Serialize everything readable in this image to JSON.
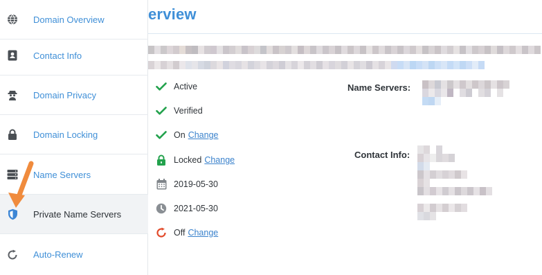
{
  "sidebar": {
    "items": [
      {
        "label": "Domain Overview",
        "icon": "globe-icon"
      },
      {
        "label": "Contact Info",
        "icon": "contact-card-icon"
      },
      {
        "label": "Domain Privacy",
        "icon": "privacy-agent-icon"
      },
      {
        "label": "Domain Locking",
        "icon": "lock-icon"
      },
      {
        "label": "Name Servers",
        "icon": "server-icon"
      },
      {
        "label": "Private Name Servers",
        "icon": "shield-icon"
      },
      {
        "label": "Auto-Renew",
        "icon": "renew-icon"
      }
    ],
    "active_item": "Private Name Servers"
  },
  "main": {
    "title_partial": "erview",
    "status": [
      {
        "icon": "check-icon",
        "text": "Active",
        "link": ""
      },
      {
        "icon": "check-icon",
        "text": "Verified",
        "link": ""
      },
      {
        "icon": "check-icon",
        "text": "On",
        "link": "Change"
      },
      {
        "icon": "lock-icon",
        "text": "Locked",
        "link": "Change"
      },
      {
        "icon": "calendar-icon",
        "text": "2019-05-30",
        "link": ""
      },
      {
        "icon": "clock-icon",
        "text": "2021-05-30",
        "link": ""
      },
      {
        "icon": "refresh-icon",
        "text": "Off",
        "link": "Change"
      }
    ],
    "name_servers_label": "Name Servers:",
    "contact_info_label": "Contact Info:"
  },
  "colors": {
    "accent": "#3f8fd7",
    "success": "#23a24d",
    "danger": "#e24b2b",
    "arrow": "#f08b3d"
  }
}
